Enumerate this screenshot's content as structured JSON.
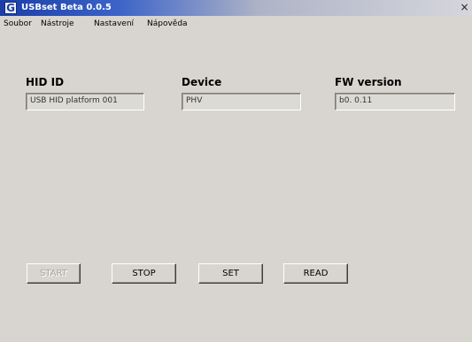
{
  "window": {
    "title": "USBset Beta 0.0.5",
    "app_icon_glyph": "G",
    "close_glyph": "×"
  },
  "menu": {
    "items": [
      "Soubor",
      "Nástroje",
      "Nastavení",
      "Nápověda"
    ]
  },
  "fields": [
    {
      "label": "HID ID",
      "value": "USB HID platform   001"
    },
    {
      "label": "Device",
      "value": "PHV"
    },
    {
      "label": "FW version",
      "value": "b0. 0.11"
    }
  ],
  "buttons": [
    {
      "label": "START",
      "enabled": false
    },
    {
      "label": "STOP",
      "enabled": true
    },
    {
      "label": "SET",
      "enabled": true
    },
    {
      "label": "READ",
      "enabled": true
    }
  ],
  "colors": {
    "titlebar_start": "#1b3ea8",
    "window_background": "#d8d5d0"
  }
}
